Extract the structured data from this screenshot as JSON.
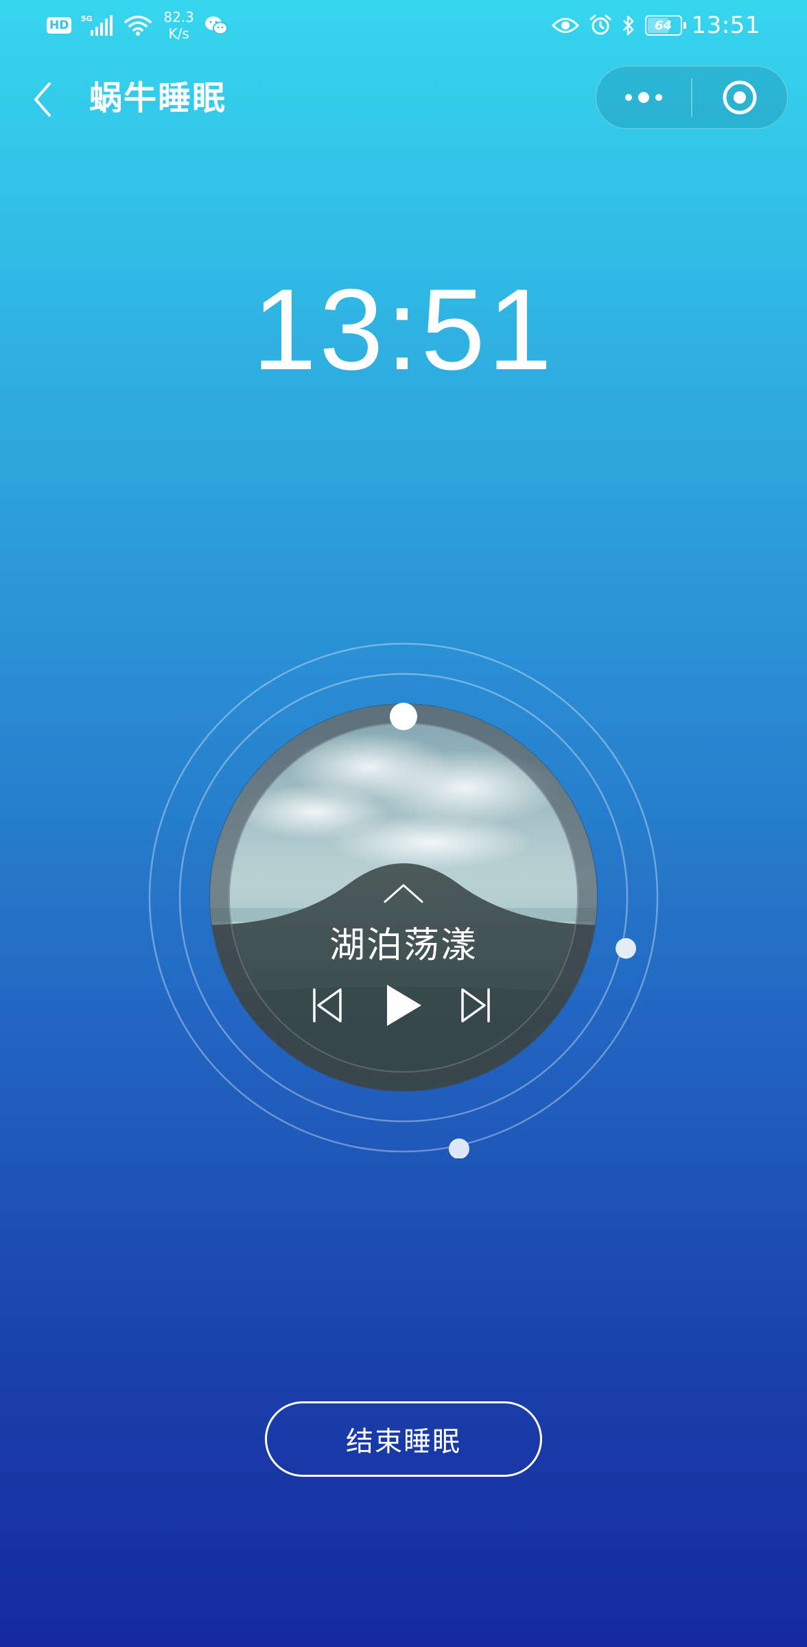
{
  "status_bar": {
    "hd_badge": "HD",
    "network": "5G",
    "speed_value": "82.3",
    "speed_unit": "K/s",
    "battery": "64",
    "time": "13:51"
  },
  "nav": {
    "title": "蜗牛睡眠"
  },
  "clock": {
    "time": "13:51"
  },
  "player": {
    "track_title": "湖泊荡漾"
  },
  "actions": {
    "end_sleep_label": "结束睡眠"
  },
  "colors": {
    "background_top": "#36d6ef",
    "background_bottom": "#1529a0",
    "foreground": "#ffffff"
  },
  "icons": {
    "back": "chevron-left-icon",
    "more": "more-dots-icon",
    "close": "target-circle-icon",
    "expand": "chevron-up-icon",
    "prev": "skip-previous-icon",
    "play": "play-icon",
    "next": "skip-next-icon"
  }
}
